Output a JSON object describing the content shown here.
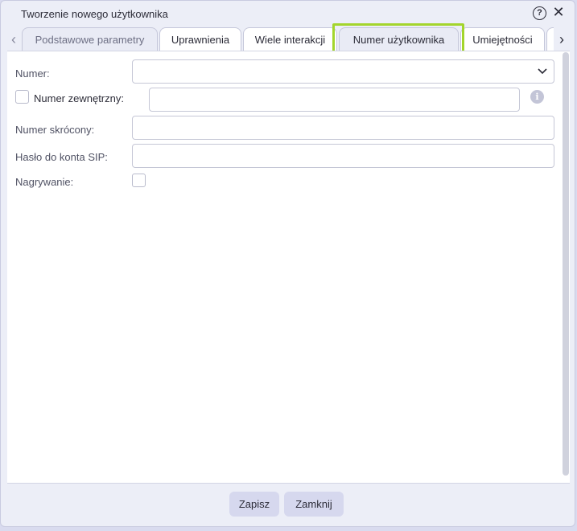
{
  "dialog": {
    "title": "Tworzenie nowego użytkownika"
  },
  "icons": {
    "help": "?",
    "close": "✕",
    "prev": "‹",
    "next": "›",
    "info": "i"
  },
  "tabs": [
    {
      "label": "Podstawowe parametry",
      "state": "inactive"
    },
    {
      "label": "Uprawnienia",
      "state": "normal"
    },
    {
      "label": "Wiele interakcji",
      "state": "normal"
    },
    {
      "label": "Numer użytkownika",
      "state": "selected"
    },
    {
      "label": "Umiejętności",
      "state": "normal"
    },
    {
      "label": "",
      "state": "partial"
    }
  ],
  "form": {
    "numer_label": "Numer:",
    "numer_value": "",
    "external_label": "Numer zewnętrzny:",
    "external_checked": false,
    "external_value": "",
    "short_label": "Numer skrócony:",
    "short_value": "",
    "sip_label": "Hasło do konta SIP:",
    "sip_value": "",
    "recording_label": "Nagrywanie:",
    "recording_checked": false
  },
  "footer": {
    "save_label": "Zapisz",
    "close_label": "Zamknij"
  },
  "colors": {
    "highlight": "#a3d52c",
    "background": "#eceef7",
    "button": "#d6d8ee"
  }
}
